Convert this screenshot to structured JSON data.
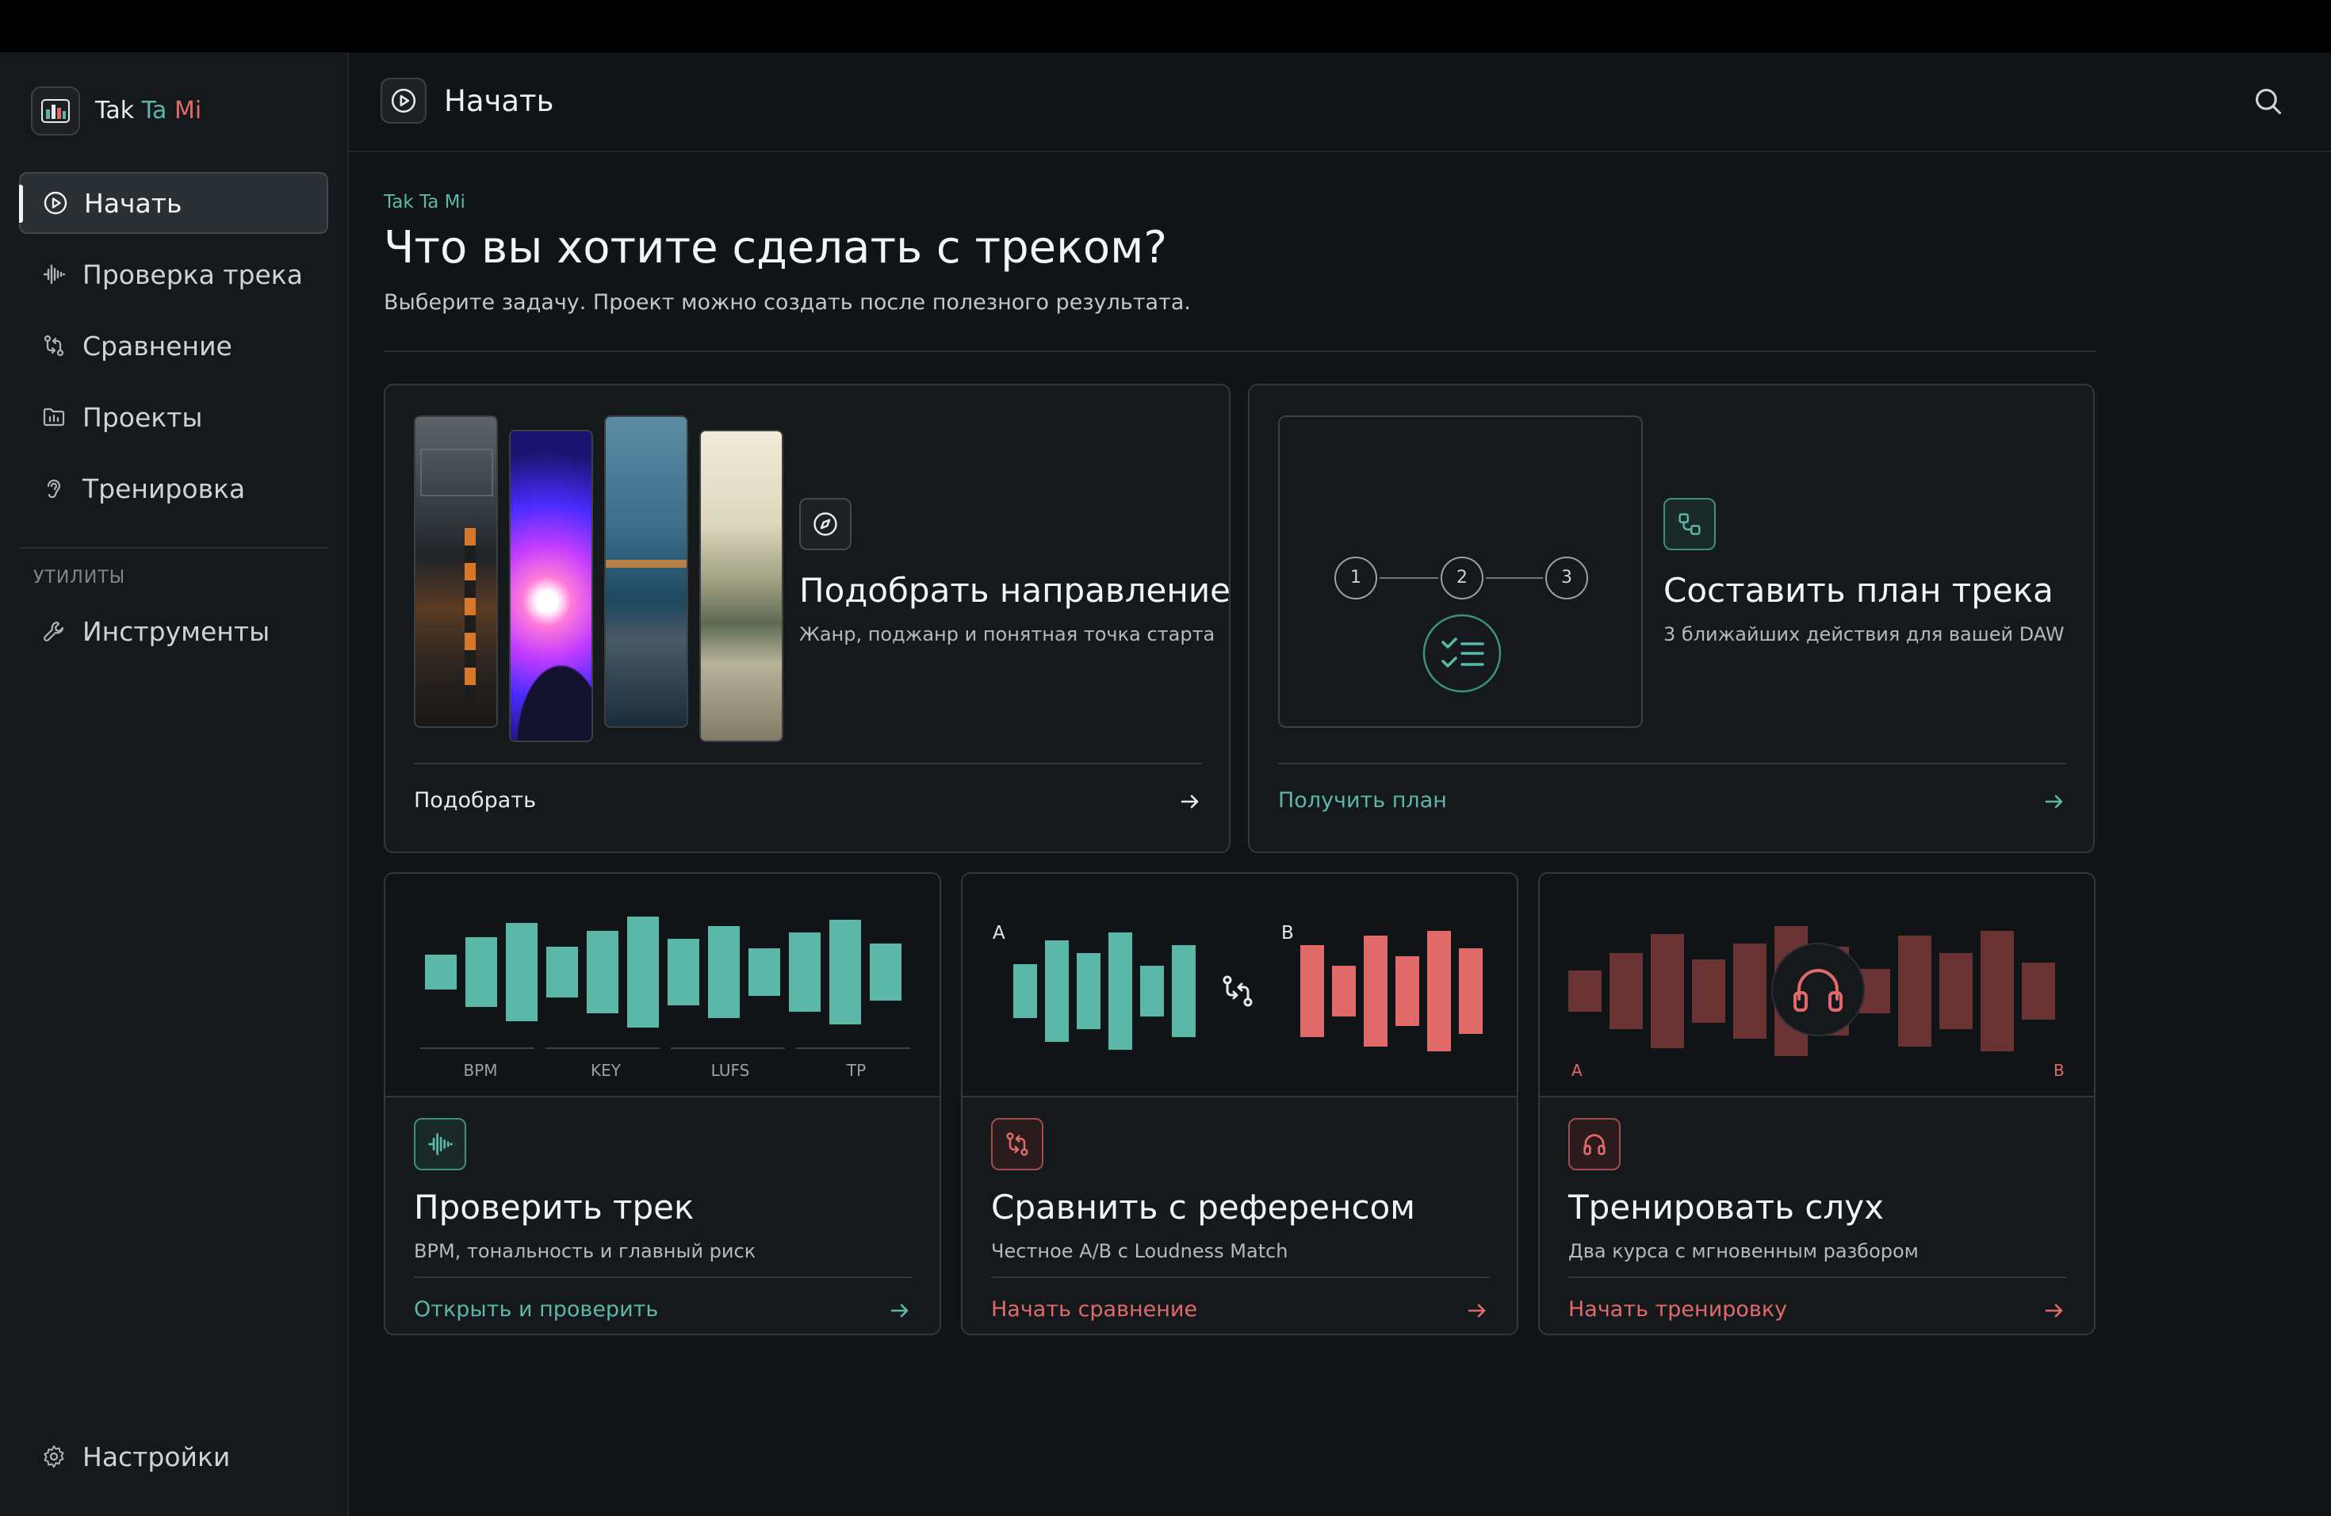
{
  "brand": {
    "part1": "Tak",
    "part2": "Ta",
    "part3": "Mi"
  },
  "sidebar": {
    "items": [
      {
        "label": "Начать",
        "icon": "play-circle-icon",
        "active": true
      },
      {
        "label": "Проверка трека",
        "icon": "waveform-icon"
      },
      {
        "label": "Сравнение",
        "icon": "compare-arrows-icon"
      },
      {
        "label": "Проекты",
        "icon": "folder-icon"
      },
      {
        "label": "Тренировка",
        "icon": "ear-icon"
      }
    ],
    "utilities_label": "УТИЛИТЫ",
    "tools_label": "Инструменты",
    "settings_label": "Настройки"
  },
  "header": {
    "title": "Начать",
    "icon": "play-circle-icon",
    "search_icon": "search-icon"
  },
  "page": {
    "eyebrow": "Tak Ta Mi",
    "title": "Что вы хотите сделать с треком?",
    "subtitle": "Выберите задачу. Проект можно создать после полезного результата."
  },
  "cards": {
    "direction": {
      "title": "Подобрать направление",
      "subtitle": "Жанр, поджанр и понятная точка старта",
      "cta": "Подобрать",
      "icon": "compass-icon"
    },
    "plan": {
      "title": "Составить план трека",
      "subtitle": "3 ближайших действия для вашей DAW",
      "cta": "Получить план",
      "icon": "flow-icon",
      "steps": [
        "1",
        "2",
        "3"
      ]
    },
    "check": {
      "title": "Проверить трек",
      "subtitle": "BPM, тональность и главный риск",
      "cta": "Открыть и проверить",
      "icon": "waveform-icon",
      "metrics": [
        "BPM",
        "KEY",
        "LUFS",
        "TP"
      ]
    },
    "compare": {
      "title": "Сравнить с референсом",
      "subtitle": "Честное A/B с Loudness Match",
      "cta": "Начать сравнение",
      "icon": "compare-arrows-icon",
      "label_a": "A",
      "label_b": "B"
    },
    "training": {
      "title": "Тренировать слух",
      "subtitle": "Два курса с мгновенным разбором",
      "cta": "Начать тренировку",
      "icon": "headphones-icon",
      "label_a": "A",
      "label_b": "B"
    }
  },
  "colors": {
    "accent_teal": "#5bb8a8",
    "accent_red": "#e06a6a",
    "background": "#111417",
    "sidebar": "#16191c"
  }
}
